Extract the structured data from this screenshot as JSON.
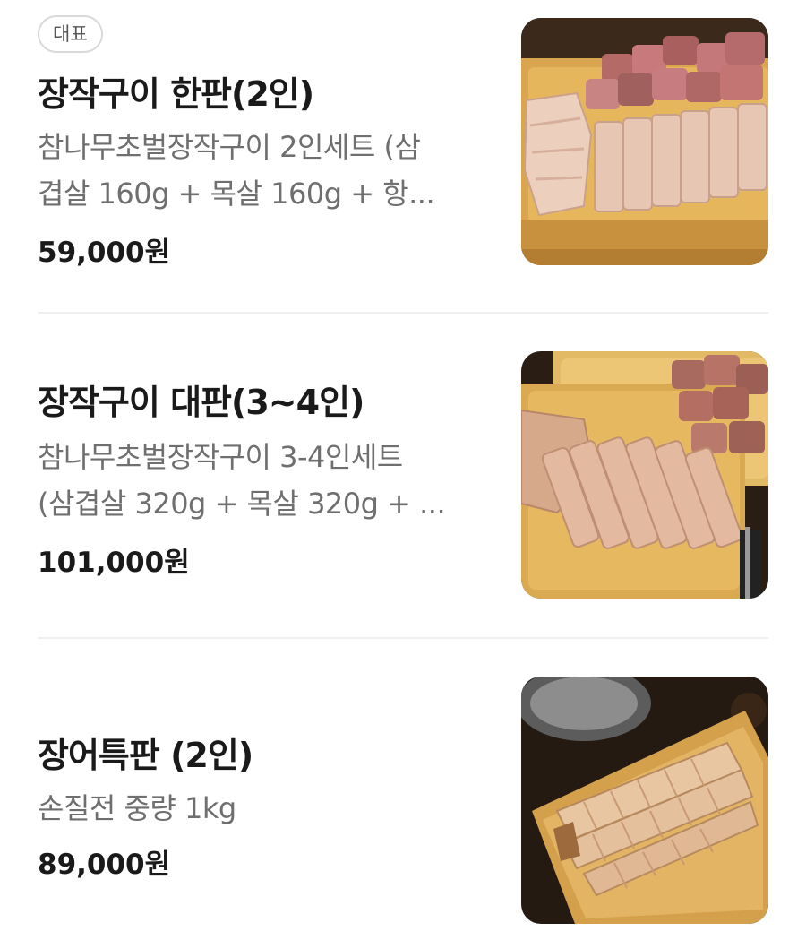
{
  "menu": {
    "items": [
      {
        "badge": "대표",
        "title": "장작구이 한판(2인)",
        "description_lines": [
          "참나무초벌장작구이 2인세트 (삼",
          "겹살 160g + 목살 160g + 항..."
        ],
        "price": "59,000",
        "currency": "원",
        "image_icon": "pork-platter-image"
      },
      {
        "title": "장작구이 대판(3~4인)",
        "description_lines": [
          "참나무초벌장작구이 3-4인세트",
          "(삼겹살 320g + 목살 320g + ..."
        ],
        "price": "101,000",
        "currency": "원",
        "image_icon": "pork-large-platter-image"
      },
      {
        "title": "장어특판 (2인)",
        "description_lines": [
          "손질전 중량 1kg"
        ],
        "price": "89,000",
        "currency": "원",
        "image_icon": "grilled-eel-platter-image"
      }
    ]
  },
  "colors": {
    "title": "#1a1a1a",
    "description": "#6f6f6f",
    "badge_border": "#d9d9d9",
    "divider": "#efefef"
  }
}
